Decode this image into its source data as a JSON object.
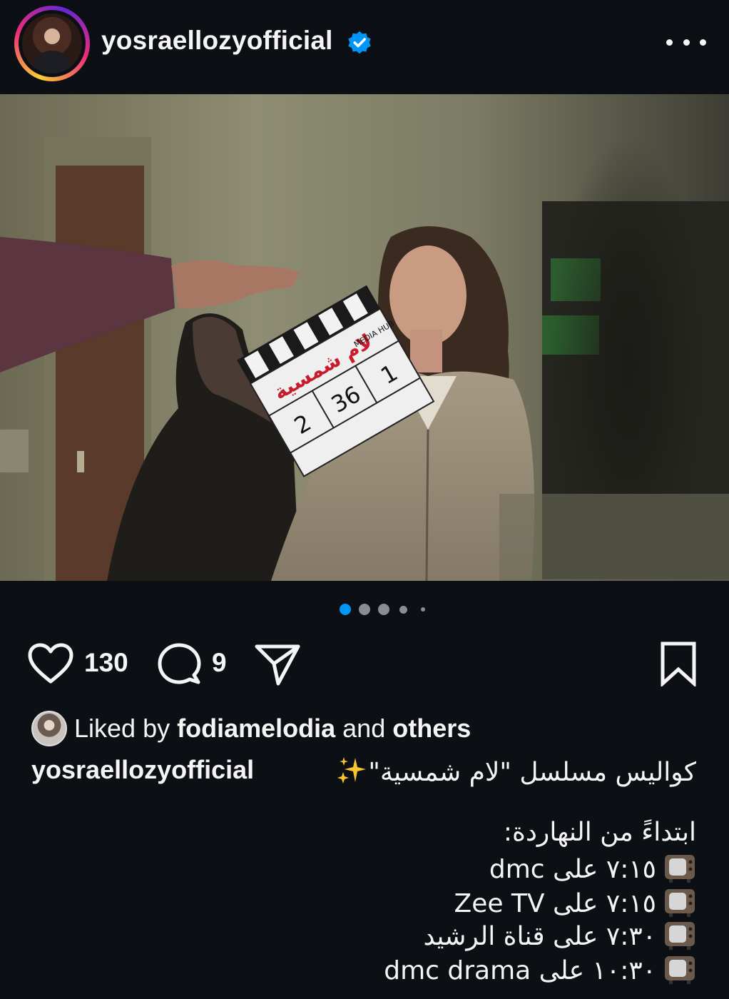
{
  "header": {
    "username": "yosraellozyofficial",
    "verified_icon": "verified-badge-icon",
    "more_icon": "more-options-icon"
  },
  "carousel": {
    "slide_count": 5,
    "active_index": 0
  },
  "actions": {
    "like_count": "130",
    "comment_count": "9",
    "icons": [
      "heart-icon",
      "comment-icon",
      "share-icon",
      "bookmark-icon"
    ]
  },
  "likes": {
    "prefix": "Liked by",
    "user": "fodiamelodia",
    "middle": "and",
    "others": "others"
  },
  "caption": {
    "username": "yosraellozyofficial",
    "title": "كواليس مسلسل \"لام شمسية\"",
    "intro": "ابتداءً من النهاردة:",
    "schedule": [
      "٧:١٥ على dmc",
      "٧:١٥ على Zee TV",
      "٧:٣٠ على قناة الرشيد",
      "١٠:٣٠ على dmc drama"
    ]
  },
  "clapperboard": {
    "title": "لام شمسية",
    "episode": "2",
    "scene": "36",
    "shot": "1",
    "take": "II",
    "studio": "MEDIA HUB"
  },
  "colors": {
    "background": "#0c1014",
    "text": "#f5f5f5",
    "accent_dot": "#0095f6",
    "verified": "#0095f6"
  }
}
